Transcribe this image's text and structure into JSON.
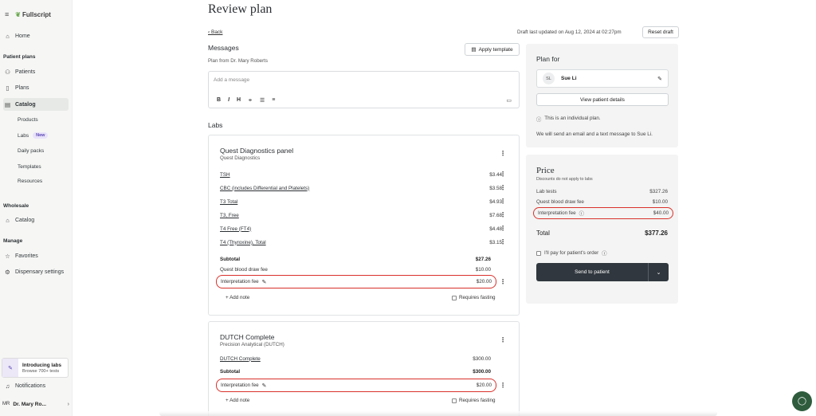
{
  "sidebar": {
    "logo_text": "Fullscript",
    "items": {
      "home": "Home",
      "patient_plans_header": "Patient plans",
      "patients": "Patients",
      "plans": "Plans",
      "catalog": "Catalog",
      "products": "Products",
      "labs": "Labs",
      "labs_badge": "New",
      "daily_packs": "Daily packs",
      "templates": "Templates",
      "resources": "Resources",
      "wholesale_header": "Wholesale",
      "wholesale_catalog": "Catalog",
      "manage_header": "Manage",
      "favorites": "Favorites",
      "dispensary_settings": "Dispensary settings",
      "notifications": "Notifications"
    },
    "intro_card": {
      "title": "Introducing labs",
      "subtitle": "Browse 700+ tests"
    },
    "user": {
      "initials": "MR",
      "name": "Dr. Mary Ro..."
    }
  },
  "header": {
    "title": "Review plan",
    "back": "Back",
    "draft_info": "Draft last updated on Aug 12, 2024 at 02:27pm",
    "reset_draft": "Reset draft"
  },
  "messages": {
    "title": "Messages",
    "from": "Plan from Dr. Mary Roberts",
    "apply_template": "Apply template",
    "placeholder": "Add a message",
    "toolbar": [
      "B",
      "I",
      "H",
      "⚭",
      "☰",
      "≡"
    ]
  },
  "labs": {
    "title": "Labs",
    "panels": [
      {
        "title": "Quest Diagnostics panel",
        "provider": "Quest Diagnostics",
        "tests": [
          {
            "name": "TSH",
            "price": "$3.44"
          },
          {
            "name": "CBC (includes Differential and Platelets)",
            "price": "$3.58"
          },
          {
            "name": "T3 Total",
            "price": "$4.93"
          },
          {
            "name": "T3, Free",
            "price": "$7.68"
          },
          {
            "name": "T4 Free (FT4)",
            "price": "$4.48"
          },
          {
            "name": "T4 (Thyroxine), Total",
            "price": "$3.15"
          }
        ],
        "subtotal_label": "Subtotal",
        "subtotal": "$27.26",
        "draw_fee_label": "Quest blood draw fee",
        "draw_fee": "$10.00",
        "interp_fee_label": "Interpretation fee",
        "interp_fee": "$20.00",
        "add_note": "+ Add note",
        "fasting": "Requires fasting"
      },
      {
        "title": "DUTCH Complete",
        "provider": "Precision Analytical (DUTCH)",
        "tests": [
          {
            "name": "DUTCH Complete",
            "price": "$300.00"
          }
        ],
        "subtotal_label": "Subtotal",
        "subtotal": "$300.00",
        "interp_fee_label": "Interpretation fee",
        "interp_fee": "$20.00",
        "add_note": "+ Add note",
        "fasting": "Requires fasting"
      }
    ]
  },
  "plan_for": {
    "title": "Plan for",
    "patient_initials": "SL",
    "patient_name": "Sue Li",
    "view_details": "View patient details",
    "individual_note": "This is an individual plan.",
    "notify_note": "We will send an email and a text message to Sue Li."
  },
  "price": {
    "title": "Price",
    "note": "Discounts do not apply to labs",
    "rows": [
      {
        "label": "Lab tests",
        "value": "$327.26"
      },
      {
        "label": "Quest blood draw fee",
        "value": "$10.00"
      }
    ],
    "interp_label": "Interpretation fee",
    "interp_value": "$40.00",
    "total_label": "Total",
    "total_value": "$377.26",
    "pay_label": "I'll pay for patient's order",
    "send_label": "Send to patient"
  },
  "colors": {
    "highlight": "#d9312b",
    "primary_button": "#30373e",
    "chat": "#2e5c3d"
  }
}
